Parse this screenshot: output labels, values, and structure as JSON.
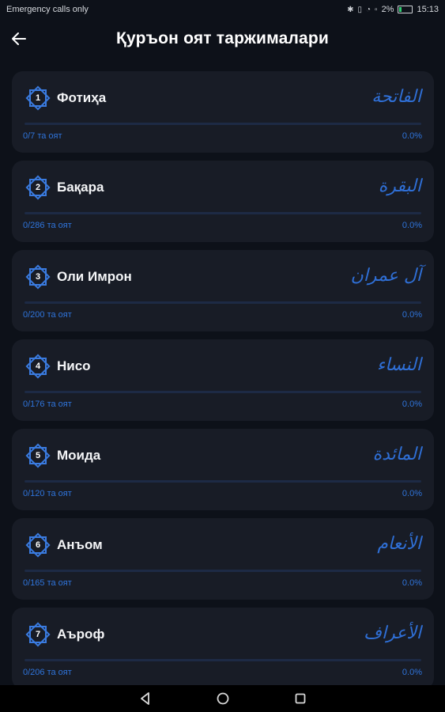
{
  "status_bar": {
    "carrier": "Emergency calls only",
    "battery_percent": "2%",
    "time": "15:13",
    "icons": [
      "bluetooth-icon",
      "vibrate-icon",
      "wifi-icon",
      "sim-icon",
      "battery-icon"
    ]
  },
  "header": {
    "title": "Қуръон оят таржималари",
    "back_icon": "arrow-left-icon"
  },
  "surahs": [
    {
      "number": "1",
      "name": "Фотиҳа",
      "arabic": "الفاتحة",
      "ayahs": "0/7 та оят",
      "percent": "0.0%",
      "progress": 0
    },
    {
      "number": "2",
      "name": "Бақара",
      "arabic": "البقرة",
      "ayahs": "0/286 та оят",
      "percent": "0.0%",
      "progress": 0
    },
    {
      "number": "3",
      "name": "Оли Имрон",
      "arabic": "آل عمران",
      "ayahs": "0/200 та оят",
      "percent": "0.0%",
      "progress": 0
    },
    {
      "number": "4",
      "name": "Нисо",
      "arabic": "النساء",
      "ayahs": "0/176 та оят",
      "percent": "0.0%",
      "progress": 0
    },
    {
      "number": "5",
      "name": "Моида",
      "arabic": "المائدة",
      "ayahs": "0/120 та оят",
      "percent": "0.0%",
      "progress": 0
    },
    {
      "number": "6",
      "name": "Анъом",
      "arabic": "الأنعام",
      "ayahs": "0/165 та оят",
      "percent": "0.0%",
      "progress": 0
    },
    {
      "number": "7",
      "name": "Аъроф",
      "arabic": "الأعراف",
      "ayahs": "0/206 та оят",
      "percent": "0.0%",
      "progress": 0
    }
  ],
  "nav": {
    "icons": [
      "back-triangle-icon",
      "home-circle-icon",
      "recents-square-icon"
    ]
  },
  "colors": {
    "background": "#0d1119",
    "card": "#181c26",
    "accent": "#2f6fd6",
    "track": "#1d2a45"
  }
}
